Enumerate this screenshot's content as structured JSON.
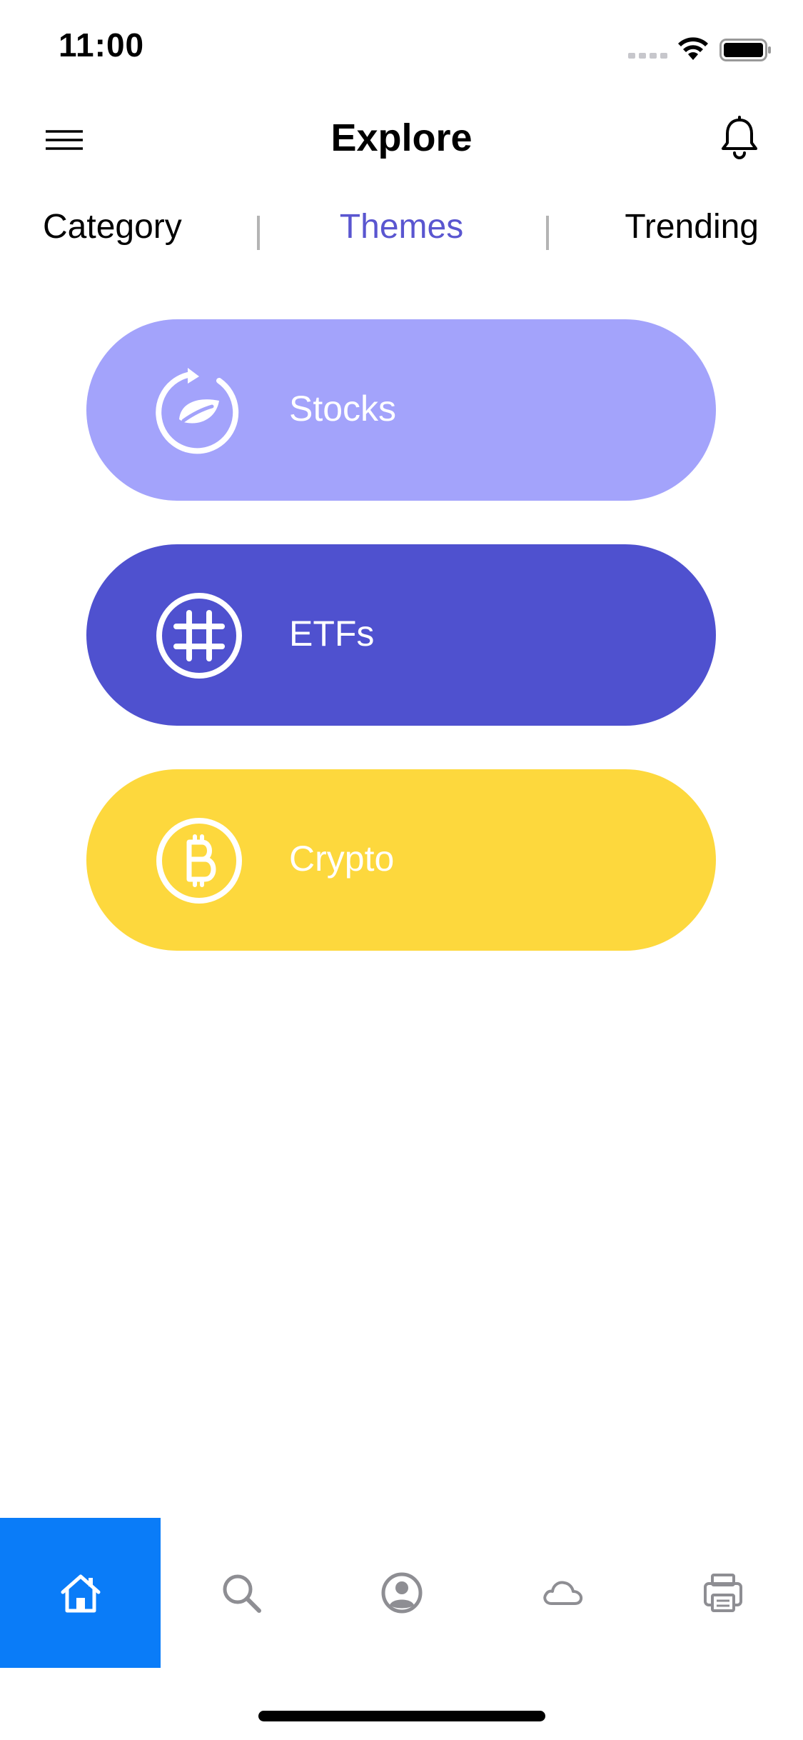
{
  "status_bar": {
    "time": "11:00"
  },
  "header": {
    "title": "Explore",
    "menu_icon": "hamburger-menu-icon",
    "notification_icon": "bell-icon"
  },
  "tabs": [
    {
      "label": "Category",
      "active": false
    },
    {
      "label": "Themes",
      "active": true
    },
    {
      "label": "Trending",
      "active": false
    }
  ],
  "themes": [
    {
      "label": "Stocks",
      "icon": "leaf-refresh-icon",
      "color": "#a3a3fb"
    },
    {
      "label": "ETFs",
      "icon": "hashtag-icon",
      "color": "#4f51cf"
    },
    {
      "label": "Crypto",
      "icon": "bitcoin-icon",
      "color": "#fdd83d"
    }
  ],
  "tab_bar": {
    "items": [
      {
        "icon": "home-icon",
        "active": true
      },
      {
        "icon": "search-icon",
        "active": false
      },
      {
        "icon": "profile-icon",
        "active": false
      },
      {
        "icon": "cloud-icon",
        "active": false
      },
      {
        "icon": "printer-icon",
        "active": false
      }
    ]
  },
  "colors": {
    "accent": "#5a56d0",
    "tab_bar_active": "#0a7cf8",
    "icon_inactive": "#8e8e93"
  }
}
